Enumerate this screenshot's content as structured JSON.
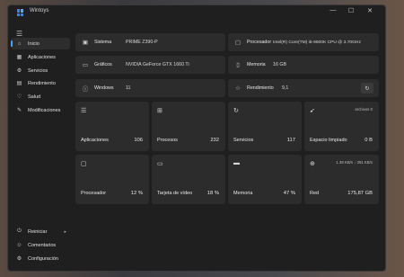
{
  "window": {
    "title": "Wintoys"
  },
  "controls": {
    "minimize": "—",
    "maximize": "☐",
    "close": "✕"
  },
  "menu_icon": "☰",
  "sidebar": {
    "items": [
      {
        "label": "Inicio",
        "icon": "home-icon",
        "glyph": "⌂"
      },
      {
        "label": "Aplicaciones",
        "icon": "apps-icon",
        "glyph": "▦"
      },
      {
        "label": "Servicios",
        "icon": "services-icon",
        "glyph": "⚙"
      },
      {
        "label": "Rendimiento",
        "icon": "performance-icon",
        "glyph": "▤"
      },
      {
        "label": "Salud",
        "icon": "health-icon",
        "glyph": "♡"
      },
      {
        "label": "Modificaciones",
        "icon": "tweaks-icon",
        "glyph": "✎"
      }
    ],
    "footer": [
      {
        "label": "Reiniciar",
        "icon": "power-icon",
        "glyph": "⏻",
        "chevron": "▸"
      },
      {
        "label": "Comentarios",
        "icon": "feedback-icon",
        "glyph": "☺"
      },
      {
        "label": "Configuración",
        "icon": "settings-icon",
        "glyph": "⚙"
      }
    ]
  },
  "info": {
    "system_label": "Sistema",
    "system_value": "PRIME Z390-P",
    "processor_label": "Procesador",
    "processor_value": "Intel(R) Core(TM) i5-9600K CPU @ 3.70GHz",
    "graphics_label": "Gráficos",
    "graphics_value": "NVIDIA GeForce GTX 1660 Ti",
    "memory_label": "Memoria",
    "memory_value": "16 GB",
    "windows_label": "Windows",
    "windows_value": "11",
    "performance_label": "Rendimiento",
    "performance_value": "9,1",
    "refresh_glyph": "↻"
  },
  "stats": {
    "apps_label": "Aplicaciones",
    "apps_value": "106",
    "processes_label": "Procesos",
    "processes_value": "232",
    "services_label": "Servicios",
    "services_value": "117",
    "cleaned_label": "Espacio limpiado",
    "cleaned_value": "0 B",
    "cleaned_extra": "archivos 0",
    "cpu_label": "Procesador",
    "cpu_value": "12 %",
    "gpu_label": "Tarjeta de vídeo",
    "gpu_value": "18 %",
    "ram_label": "Memoria",
    "ram_value": "47 %",
    "net_label": "Red",
    "net_value": "175,87 GB",
    "net_extra": "1.39 KB/s ↓ 391 KB/s"
  }
}
